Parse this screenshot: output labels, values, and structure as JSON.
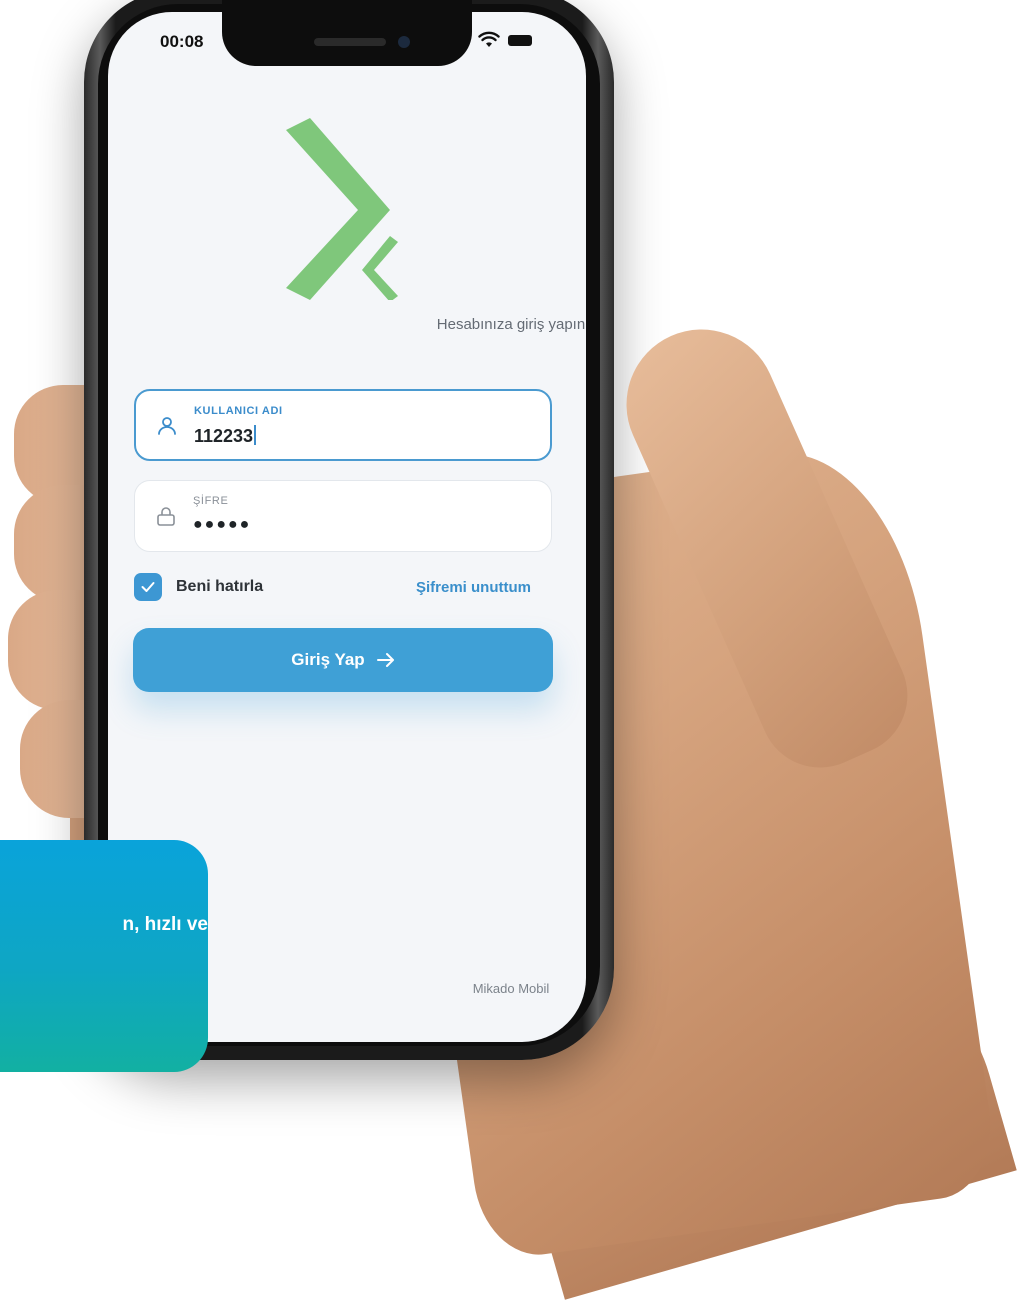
{
  "status_bar": {
    "time": "00:08"
  },
  "login": {
    "subtitle": "Hesabınıza giriş yapın",
    "username_label": "KULLANICI ADI",
    "username_value": "112233",
    "password_label": "ŞİFRE",
    "password_value": "●●●●●",
    "remember_label": "Beni hatırla",
    "remember_checked": true,
    "forgot_label": "Şifremi unuttum",
    "submit_label": "Giriş Yap",
    "footer": "Mikado Mobil"
  },
  "promo": {
    "text": "n, hızlı ve"
  },
  "colors": {
    "accent": "#3fa0d6",
    "logo": "#7fc77b",
    "promo_top": "#0aa3da",
    "promo_bottom": "#12b0a2"
  },
  "icons": [
    "wifi-icon",
    "battery-icon",
    "user-icon",
    "lock-icon",
    "check-icon",
    "arrow-right-icon"
  ]
}
